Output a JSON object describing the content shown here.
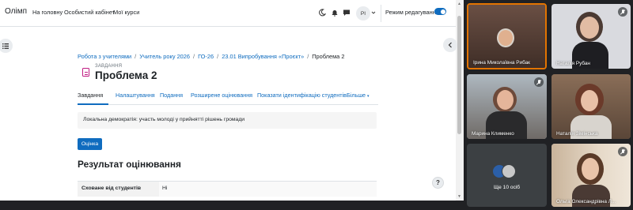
{
  "browser": {
    "brand": "Олімп",
    "nav": [
      "На головну",
      "Особистий кабінет",
      "Мої курси"
    ],
    "avatar_initials": "PI",
    "edit_mode_label": "Режим редагування",
    "edit_mode_on": true
  },
  "breadcrumb": {
    "items": [
      "Робота з учителями",
      "Учитель року 2026",
      "ГО-26",
      "23.01 Випробування «Проєкт»"
    ],
    "current": "Проблема 2"
  },
  "activity": {
    "pretitle": "ЗАВДАННЯ",
    "title": "Проблема 2"
  },
  "tabs": [
    "Завдання",
    "Налаштування",
    "Подання",
    "Розширене оцінювання",
    "Показати ідентифікацію студентів",
    "Більше"
  ],
  "description": "Локальна демократія: участь молоді у прийнятті рішень громади",
  "grade_button": "Оцінка",
  "section_heading": "Результат оцінювання",
  "table": {
    "label": "Сховане від студентів",
    "value": "Ні"
  },
  "help_label": "?",
  "participants": [
    {
      "name": "Ірина Миколаївна Рибак",
      "muted": false,
      "active": true
    },
    {
      "name": "Наталія Рубан",
      "muted": true,
      "active": false
    },
    {
      "name": "Марина Клименко",
      "muted": true,
      "active": false
    },
    {
      "name": "Наталія Зімінська",
      "muted": false,
      "active": false
    },
    {
      "name": "Ольга Олександрівна Л...",
      "muted": true,
      "active": false
    }
  ],
  "more_tile": {
    "label": "Ще 10 осіб"
  },
  "colors": {
    "accent": "#0f6cbf",
    "meet_bg": "#202124",
    "active_border": "#e37400"
  }
}
